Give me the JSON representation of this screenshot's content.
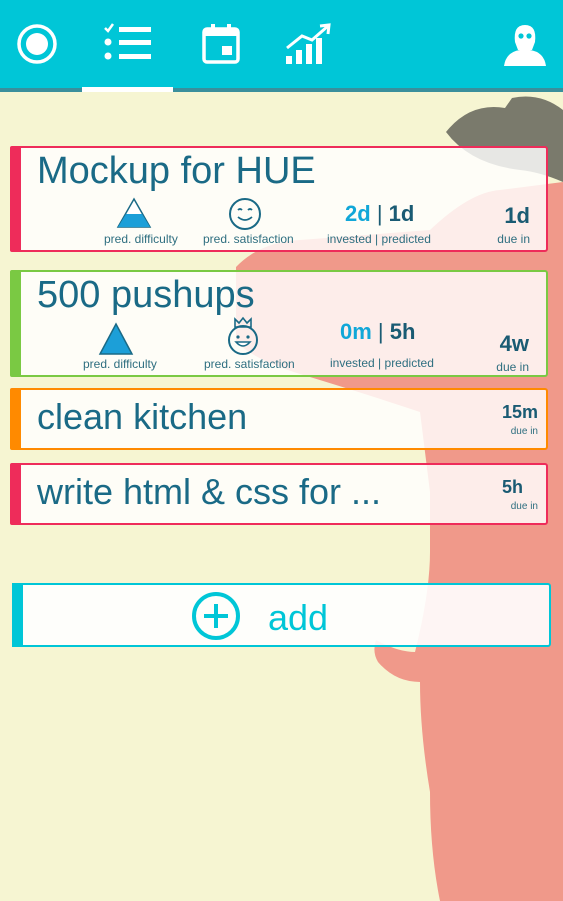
{
  "app": {
    "tabs": [
      {
        "name": "focus",
        "icon": "target-icon"
      },
      {
        "name": "tasks",
        "icon": "checklist-icon",
        "active": true
      },
      {
        "name": "calendar",
        "icon": "calendar-icon"
      },
      {
        "name": "statistics",
        "icon": "stats-chart-icon"
      },
      {
        "name": "profile",
        "icon": "avatar-icon"
      }
    ],
    "accent_color": "#00c6d7"
  },
  "labels": {
    "difficulty": "pred. difficulty",
    "satisfaction": "pred. satisfaction",
    "invested": "invested",
    "separator": "|",
    "predicted": "predicted",
    "due": "due in"
  },
  "tasks": [
    {
      "title": "Mockup for HUE",
      "color": "#ee2c5a",
      "invested": "2d",
      "predicted": "1d",
      "due": "1d",
      "difficulty_icon": "mountain-icon",
      "satisfaction_icon": "smiley-icon"
    },
    {
      "title": "500 pushups",
      "color": "#7ac943",
      "invested": "0m",
      "predicted": "5h",
      "due": "4w",
      "difficulty_icon": "mountain-icon",
      "satisfaction_icon": "crowned-smiley-icon"
    },
    {
      "title": "clean kitchen",
      "color": "#ff8a00",
      "due": "15m"
    },
    {
      "title": "write html & css for ...",
      "color": "#ee2c5a",
      "due": "5h"
    }
  ],
  "add": {
    "label": "add",
    "icon": "plus-circle-icon"
  }
}
